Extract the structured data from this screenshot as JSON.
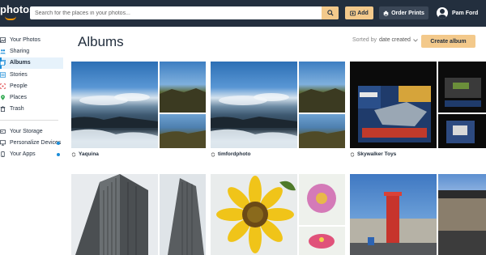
{
  "header": {
    "logo": "photos",
    "search_placeholder": "Search for the places in your photos...",
    "add_label": "Add",
    "order_label": "Order Prints",
    "user_name": "Pam Ford"
  },
  "sidebar": {
    "items": [
      {
        "label": "Your Photos",
        "icon": "image-icon"
      },
      {
        "label": "Sharing",
        "icon": "people-icon"
      },
      {
        "label": "Albums",
        "icon": "albums-icon",
        "active": true
      },
      {
        "label": "Stories",
        "icon": "stories-icon"
      },
      {
        "label": "People",
        "icon": "face-icon"
      },
      {
        "label": "Places",
        "icon": "pin-icon"
      },
      {
        "label": "Trash",
        "icon": "trash-icon"
      }
    ],
    "items2": [
      {
        "label": "Your Storage",
        "icon": "cloud-icon"
      },
      {
        "label": "Personalize Devices",
        "icon": "monitor-icon",
        "dot": true
      },
      {
        "label": "Your Apps",
        "icon": "apps-icon",
        "dot": true
      }
    ]
  },
  "main": {
    "title": "Albums",
    "sort_prefix": "Sorted by",
    "sort_value": "date created",
    "create_label": "Create album",
    "albums": [
      {
        "name": "Yaquina"
      },
      {
        "name": "timfordphoto"
      },
      {
        "name": "Skywalker Toys"
      }
    ]
  },
  "colors": {
    "topbar": "#232f3e",
    "accent": "#f3c98b",
    "active": "#1a8cd8"
  }
}
